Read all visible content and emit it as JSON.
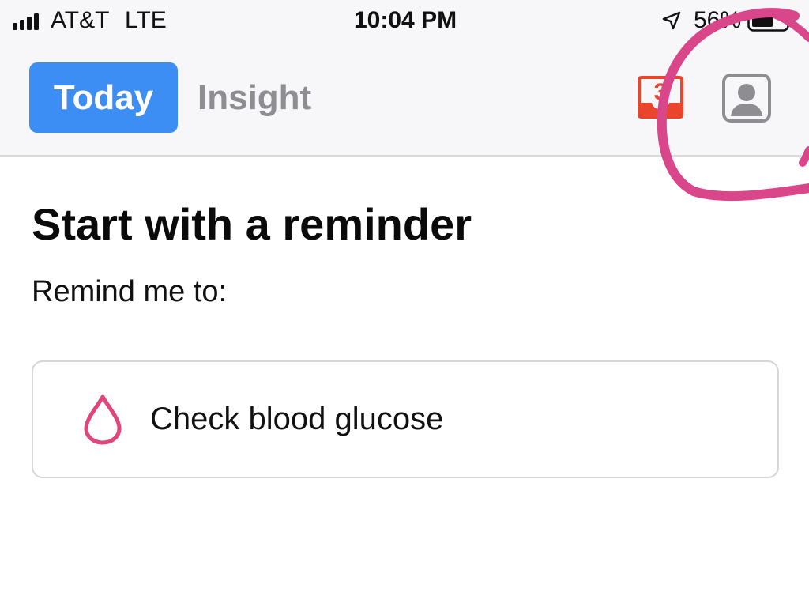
{
  "status_bar": {
    "carrier": "AT&T",
    "network": "LTE",
    "time": "10:04 PM",
    "battery": "56%",
    "icons": [
      "signal-bars-icon",
      "location-arrow-icon",
      "battery-icon"
    ]
  },
  "nav": {
    "tabs": [
      {
        "label": "Today",
        "selected": true
      },
      {
        "label": "Insight",
        "selected": false
      }
    ],
    "inbox_badge": "3",
    "icons": [
      "inbox-icon",
      "profile-icon"
    ],
    "accent_color": "#3d8ef4",
    "badge_color": "#e8452c"
  },
  "main": {
    "title": "Start with a reminder",
    "prompt": "Remind me to:",
    "reminders": [
      {
        "label": "Check blood glucose",
        "icon": "blood-drop-icon",
        "icon_color": "#e0457b"
      }
    ]
  },
  "annotation": {
    "type": "hand-drawn circle",
    "color": "#d9468a"
  }
}
